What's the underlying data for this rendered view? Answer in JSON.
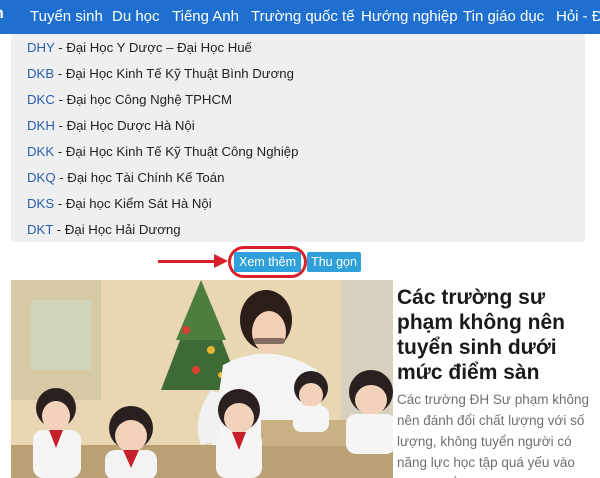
{
  "nav": {
    "logo_tail": "n",
    "items": [
      "Tuyển sinh",
      "Du học",
      "Tiếng Anh",
      "Trường quốc tế",
      "Hướng nghiệp",
      "Tin giáo dục",
      "Hỏi - Đá"
    ]
  },
  "schools": [
    {
      "code": "DHY",
      "name": " - Đại Học Y Dược – Đại Học Huế"
    },
    {
      "code": "DKB",
      "name": " - Đại Học Kinh Tế Kỹ Thuật Bình Dương"
    },
    {
      "code": "DKC",
      "name": " - Đại học Công Nghệ TPHCM"
    },
    {
      "code": "DKH",
      "name": " - Đại Học Dược Hà Nội"
    },
    {
      "code": "DKK",
      "name": " - Đại Học Kinh Tế Kỹ Thuật Công Nghiệp"
    },
    {
      "code": "DKQ",
      "name": " - Đại học Tài Chính Kế Toán"
    },
    {
      "code": "DKS",
      "name": " - Đại học Kiểm Sát Hà Nội"
    },
    {
      "code": "DKT",
      "name": " - Đại Học Hải Dương"
    }
  ],
  "buttons": {
    "more": "Xem thêm",
    "collapse": "Thu gọn"
  },
  "article": {
    "title": "Các trường sư phạm không nên tuyển sinh dưới mức điểm sàn",
    "summary": "Các trường ĐH Sư phạm không nên đánh đổi chất lượng với số lượng, không tuyển người có năng lực học tập quá yếu vào trường để sau này đi dạy học."
  },
  "colors": {
    "nav_bg": "#1f6fd0",
    "button_bg": "#2fa0da",
    "highlight": "#d9202a",
    "code_link": "#2b5fad"
  }
}
